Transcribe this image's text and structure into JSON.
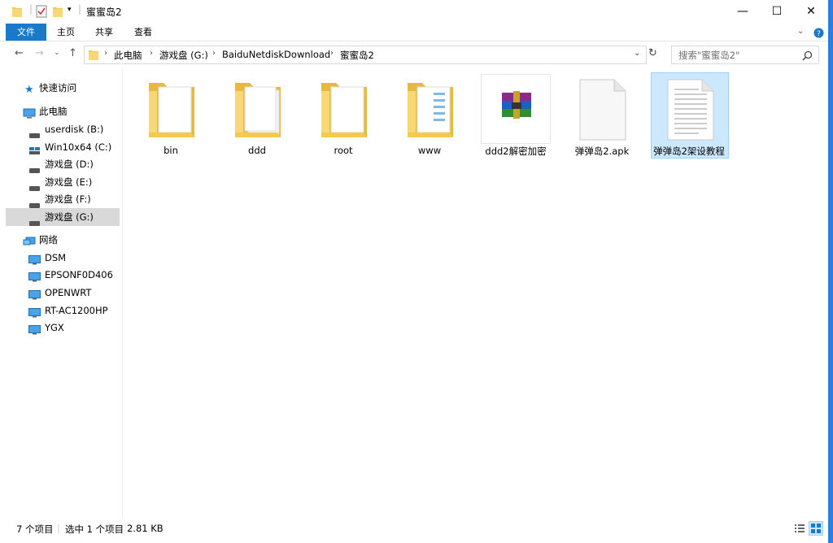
{
  "window": {
    "title": "蜜蜜岛2"
  },
  "ribbon": {
    "tabs": [
      "文件",
      "主页",
      "共享",
      "查看"
    ]
  },
  "address": {
    "crumbs": [
      "此电脑",
      "游戏盘 (G:)",
      "BaiduNetdiskDownload",
      "蜜蜜岛2"
    ],
    "search_placeholder": "搜索\"蜜蜜岛2\""
  },
  "sidebar": {
    "quick_access": "快速访问",
    "this_pc": "此电脑",
    "drives": [
      "userdisk (B:)",
      "Win10x64 (C:)",
      "游戏盘 (D:)",
      "游戏盘 (E:)",
      "游戏盘 (F:)",
      "游戏盘 (G:)"
    ],
    "network": "网络",
    "computers": [
      "DSM",
      "EPSONF0D406",
      "OPENWRT",
      "RT-AC1200HP",
      "YGX"
    ]
  },
  "files": [
    {
      "name": "bin",
      "type": "folder"
    },
    {
      "name": "ddd",
      "type": "folder"
    },
    {
      "name": "root",
      "type": "folder"
    },
    {
      "name": "www",
      "type": "folder"
    },
    {
      "name": "ddd2解密加密",
      "type": "rar"
    },
    {
      "name": "弹弹岛2.apk",
      "type": "file"
    },
    {
      "name": "弹弹岛2架设教程",
      "type": "text",
      "selected": true
    }
  ],
  "status": {
    "count": "7 个项目",
    "selection": "选中 1 个项目",
    "size": "2.81 KB"
  },
  "colors": {
    "accent": "#1979ca",
    "selection": "#cce8ff",
    "folder": "#f8d775"
  }
}
